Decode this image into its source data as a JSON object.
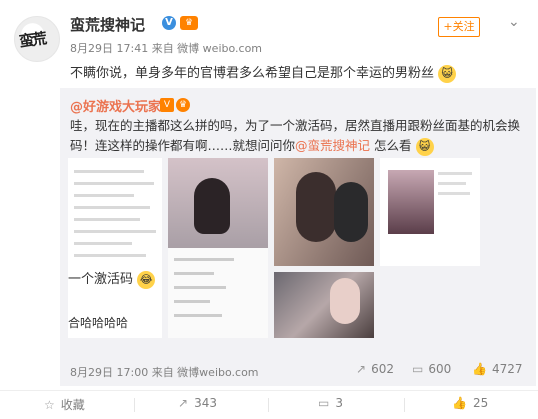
{
  "post": {
    "author": "蛮荒搜神记",
    "avatar_text": "蛮荒",
    "meta": "8月29日 17:41 来自 微博 weibo.com",
    "text": "不瞒你说，单身多年的官博君多么希望自己是那个幸运的男粉丝",
    "follow_label": "+关注",
    "emoji": "猫"
  },
  "repost": {
    "user": "@好游戏大玩家",
    "text_part1": "哇，现在的主播都这么拼的吗，为了一个激活码，居然直播用跟粉丝面基的机会换码！连这样的操作都有啊……就想问问你",
    "mention": "@蛮荒搜神记",
    "text_part2": " 怎么看",
    "emoji": "猫",
    "snippet1": "一个激活码",
    "snippet2": "合哈哈哈哈",
    "footer_time": "8月29日 17:00 来自 微博weibo.com",
    "stats": {
      "share": "602",
      "comment": "600",
      "like": "4727"
    }
  },
  "actions": {
    "favorite": "收藏",
    "share": "343",
    "comment": "3",
    "like": "25"
  },
  "icons": {
    "share": "share-icon",
    "comment": "comment-icon",
    "like": "like-icon",
    "favorite": "star-icon",
    "more": "chevron-down-icon"
  },
  "colors": {
    "accent": "#ff8200",
    "link": "#eb7350",
    "verified": "#3b8fde"
  }
}
